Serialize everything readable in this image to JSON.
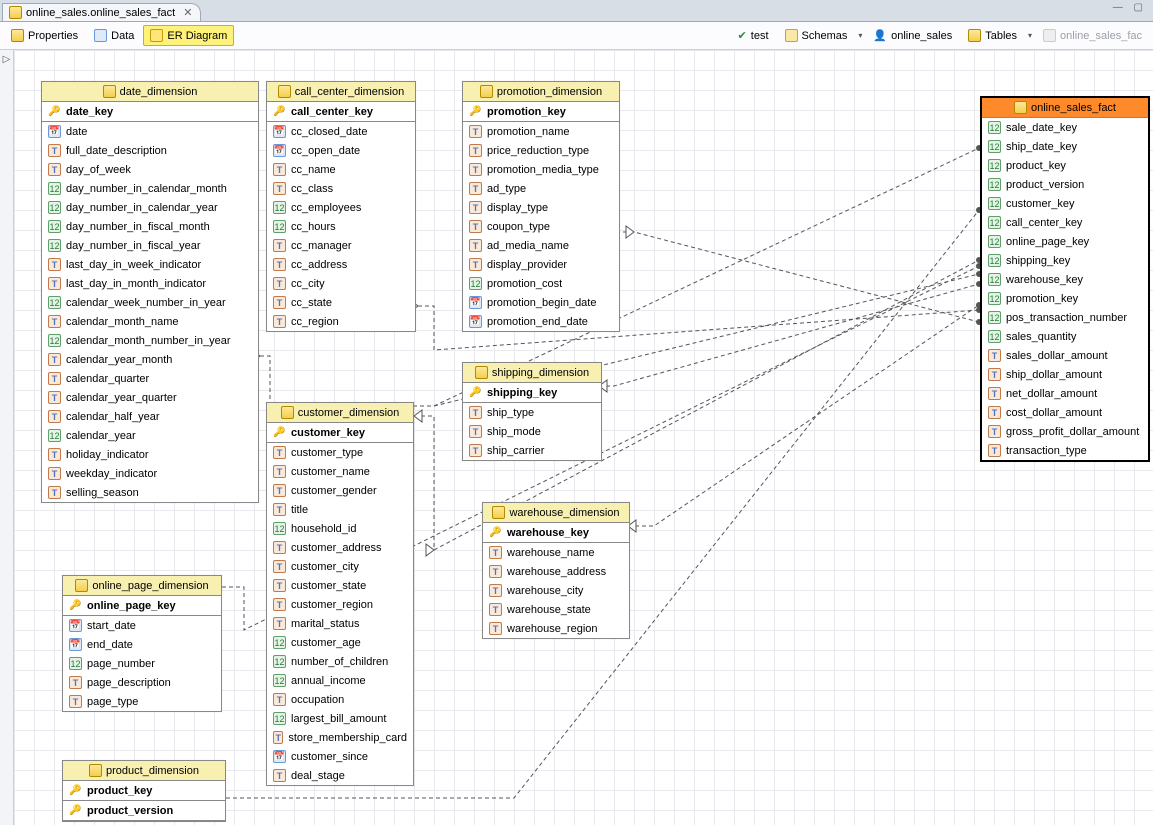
{
  "editorTab": {
    "label": "online_sales.online_sales_fact"
  },
  "toolbar": {
    "properties": "Properties",
    "data": "Data",
    "erdiagram": "ER Diagram",
    "test": "test",
    "schemas": "Schemas",
    "online_sales": "online_sales",
    "tables": "Tables",
    "online_sales_fac": "online_sales_fac"
  },
  "window_controls": "—  ▢",
  "entities": {
    "date_dimension": {
      "title": "date_dimension",
      "pk": "date_key",
      "cols": [
        {
          "t": "date",
          "n": "date"
        },
        {
          "t": "txt",
          "n": "full_date_description"
        },
        {
          "t": "txt",
          "n": "day_of_week"
        },
        {
          "t": "num",
          "n": "day_number_in_calendar_month"
        },
        {
          "t": "num",
          "n": "day_number_in_calendar_year"
        },
        {
          "t": "num",
          "n": "day_number_in_fiscal_month"
        },
        {
          "t": "num",
          "n": "day_number_in_fiscal_year"
        },
        {
          "t": "txt",
          "n": "last_day_in_week_indicator"
        },
        {
          "t": "txt",
          "n": "last_day_in_month_indicator"
        },
        {
          "t": "num",
          "n": "calendar_week_number_in_year"
        },
        {
          "t": "txt",
          "n": "calendar_month_name"
        },
        {
          "t": "num",
          "n": "calendar_month_number_in_year"
        },
        {
          "t": "txt",
          "n": "calendar_year_month"
        },
        {
          "t": "txt",
          "n": "calendar_quarter"
        },
        {
          "t": "txt",
          "n": "calendar_year_quarter"
        },
        {
          "t": "txt",
          "n": "calendar_half_year"
        },
        {
          "t": "num",
          "n": "calendar_year"
        },
        {
          "t": "txt",
          "n": "holiday_indicator"
        },
        {
          "t": "txt",
          "n": "weekday_indicator"
        },
        {
          "t": "txt",
          "n": "selling_season"
        }
      ]
    },
    "call_center_dimension": {
      "title": "call_center_dimension",
      "pk": "call_center_key",
      "cols": [
        {
          "t": "date",
          "n": "cc_closed_date"
        },
        {
          "t": "date",
          "n": "cc_open_date"
        },
        {
          "t": "txt",
          "n": "cc_name"
        },
        {
          "t": "txt",
          "n": "cc_class"
        },
        {
          "t": "num",
          "n": "cc_employees"
        },
        {
          "t": "num",
          "n": "cc_hours"
        },
        {
          "t": "txt",
          "n": "cc_manager"
        },
        {
          "t": "txt",
          "n": "cc_address"
        },
        {
          "t": "txt",
          "n": "cc_city"
        },
        {
          "t": "txt",
          "n": "cc_state"
        },
        {
          "t": "txt",
          "n": "cc_region"
        }
      ]
    },
    "promotion_dimension": {
      "title": "promotion_dimension",
      "pk": "promotion_key",
      "cols": [
        {
          "t": "txt",
          "n": "promotion_name"
        },
        {
          "t": "txt",
          "n": "price_reduction_type"
        },
        {
          "t": "txt",
          "n": "promotion_media_type"
        },
        {
          "t": "txt",
          "n": "ad_type"
        },
        {
          "t": "txt",
          "n": "display_type"
        },
        {
          "t": "txt",
          "n": "coupon_type"
        },
        {
          "t": "txt",
          "n": "ad_media_name"
        },
        {
          "t": "txt",
          "n": "display_provider"
        },
        {
          "t": "num",
          "n": "promotion_cost"
        },
        {
          "t": "date",
          "n": "promotion_begin_date"
        },
        {
          "t": "date",
          "n": "promotion_end_date"
        }
      ]
    },
    "shipping_dimension": {
      "title": "shipping_dimension",
      "pk": "shipping_key",
      "cols": [
        {
          "t": "txt",
          "n": "ship_type"
        },
        {
          "t": "txt",
          "n": "ship_mode"
        },
        {
          "t": "txt",
          "n": "ship_carrier"
        }
      ]
    },
    "customer_dimension": {
      "title": "customer_dimension",
      "pk": "customer_key",
      "cols": [
        {
          "t": "txt",
          "n": "customer_type"
        },
        {
          "t": "txt",
          "n": "customer_name"
        },
        {
          "t": "txt",
          "n": "customer_gender"
        },
        {
          "t": "txt",
          "n": "title"
        },
        {
          "t": "num",
          "n": "household_id"
        },
        {
          "t": "txt",
          "n": "customer_address"
        },
        {
          "t": "txt",
          "n": "customer_city"
        },
        {
          "t": "txt",
          "n": "customer_state"
        },
        {
          "t": "txt",
          "n": "customer_region"
        },
        {
          "t": "txt",
          "n": "marital_status"
        },
        {
          "t": "num",
          "n": "customer_age"
        },
        {
          "t": "num",
          "n": "number_of_children"
        },
        {
          "t": "num",
          "n": "annual_income"
        },
        {
          "t": "txt",
          "n": "occupation"
        },
        {
          "t": "num",
          "n": "largest_bill_amount"
        },
        {
          "t": "txt",
          "n": "store_membership_card"
        },
        {
          "t": "date",
          "n": "customer_since"
        },
        {
          "t": "txt",
          "n": "deal_stage"
        }
      ]
    },
    "warehouse_dimension": {
      "title": "warehouse_dimension",
      "pk": "warehouse_key",
      "cols": [
        {
          "t": "txt",
          "n": "warehouse_name"
        },
        {
          "t": "txt",
          "n": "warehouse_address"
        },
        {
          "t": "txt",
          "n": "warehouse_city"
        },
        {
          "t": "txt",
          "n": "warehouse_state"
        },
        {
          "t": "txt",
          "n": "warehouse_region"
        }
      ]
    },
    "online_page_dimension": {
      "title": "online_page_dimension",
      "pk": "online_page_key",
      "cols": [
        {
          "t": "date",
          "n": "start_date"
        },
        {
          "t": "date",
          "n": "end_date"
        },
        {
          "t": "num",
          "n": "page_number"
        },
        {
          "t": "txt",
          "n": "page_description"
        },
        {
          "t": "txt",
          "n": "page_type"
        }
      ]
    },
    "product_dimension": {
      "title": "product_dimension",
      "pks": [
        "product_key",
        "product_version"
      ]
    },
    "online_sales_fact": {
      "title": "online_sales_fact",
      "cols": [
        {
          "t": "num",
          "n": "sale_date_key"
        },
        {
          "t": "num",
          "n": "ship_date_key"
        },
        {
          "t": "num",
          "n": "product_key"
        },
        {
          "t": "num",
          "n": "product_version"
        },
        {
          "t": "num",
          "n": "customer_key"
        },
        {
          "t": "num",
          "n": "call_center_key"
        },
        {
          "t": "num",
          "n": "online_page_key"
        },
        {
          "t": "num",
          "n": "shipping_key"
        },
        {
          "t": "num",
          "n": "warehouse_key"
        },
        {
          "t": "num",
          "n": "promotion_key"
        },
        {
          "t": "num",
          "n": "pos_transaction_number"
        },
        {
          "t": "num",
          "n": "sales_quantity"
        },
        {
          "t": "txt",
          "n": "sales_dollar_amount"
        },
        {
          "t": "txt",
          "n": "ship_dollar_amount"
        },
        {
          "t": "txt",
          "n": "net_dollar_amount"
        },
        {
          "t": "txt",
          "n": "cost_dollar_amount"
        },
        {
          "t": "txt",
          "n": "gross_profit_dollar_amount"
        },
        {
          "t": "txt",
          "n": "transaction_type"
        }
      ]
    }
  }
}
